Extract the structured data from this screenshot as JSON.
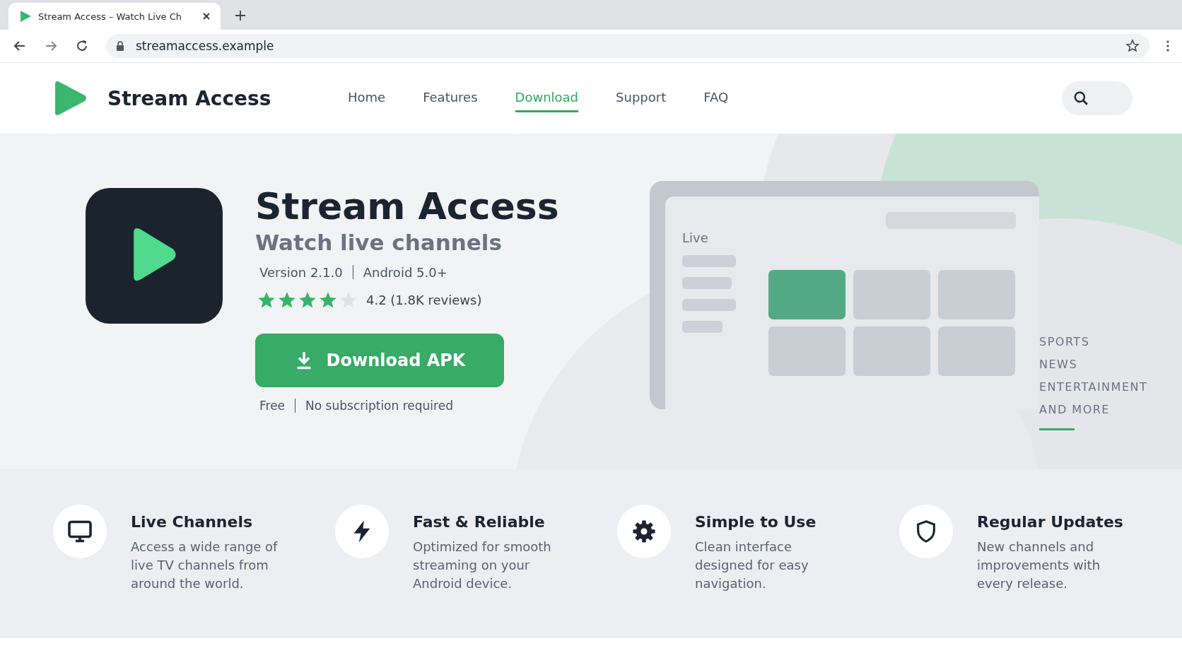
{
  "browser": {
    "tab_title": "Stream Access – Watch Live Ch",
    "url": "streamaccess.example"
  },
  "header": {
    "brand": "Stream Access",
    "nav": [
      {
        "label": "Home",
        "selected": false
      },
      {
        "label": "Features",
        "selected": false
      },
      {
        "label": "Download",
        "selected": true
      },
      {
        "label": "Support",
        "selected": false
      },
      {
        "label": "FAQ",
        "selected": false
      }
    ]
  },
  "hero": {
    "title": "Stream Access",
    "subtitle": "Watch live channels",
    "version": "Version 2.1.0",
    "platform": "Android 5.0+",
    "stars": 4,
    "rating": "4.2 (1.8K reviews)",
    "button": "Download APK",
    "price": "Free",
    "note": "No subscription required",
    "mockup_label": "Live",
    "categories": [
      "SPORTS",
      "NEWS",
      "ENTERTAINMENT",
      "AND MORE"
    ]
  },
  "features": [
    {
      "kind": "monitor",
      "title": "Live Channels",
      "text": "Access a wide range of live TV channels from around the world."
    },
    {
      "kind": "bolt",
      "title": "Fast & Reliable",
      "text": "Optimized for smooth streaming on your Android device."
    },
    {
      "kind": "gear",
      "title": "Simple to Use",
      "text": "Clean interface designed for easy navigation."
    },
    {
      "kind": "shield",
      "title": "Regular Updates",
      "text": "New channels and improvements with every release."
    }
  ]
}
